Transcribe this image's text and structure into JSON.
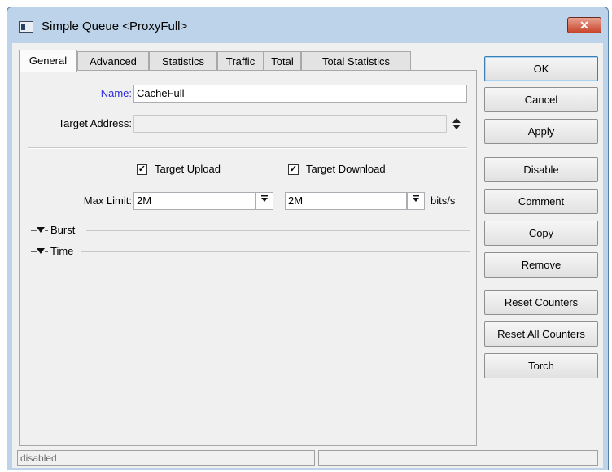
{
  "window": {
    "title": "Simple Queue <ProxyFull>",
    "close_glyph": "✕"
  },
  "tabs": [
    {
      "label": "General",
      "active": true
    },
    {
      "label": "Advanced"
    },
    {
      "label": "Statistics"
    },
    {
      "label": "Traffic"
    },
    {
      "label": "Total"
    },
    {
      "label": "Total Statistics"
    }
  ],
  "general": {
    "name_label": "Name:",
    "name_value": "CacheFull",
    "target_address_label": "Target Address:",
    "target_address_value": "",
    "target_upload_label": "Target Upload",
    "target_upload_checked": true,
    "target_download_label": "Target Download",
    "target_download_checked": true,
    "max_limit_label": "Max Limit:",
    "max_limit_upload": "2M",
    "max_limit_download": "2M",
    "max_limit_unit": "bits/s",
    "burst_label": "Burst",
    "time_label": "Time",
    "check_glyph": "✓"
  },
  "buttons": {
    "ok": "OK",
    "cancel": "Cancel",
    "apply": "Apply",
    "disable": "Disable",
    "comment": "Comment",
    "copy": "Copy",
    "remove": "Remove",
    "reset_counters": "Reset Counters",
    "reset_all_counters": "Reset All Counters",
    "torch": "Torch"
  },
  "status": {
    "left": "disabled",
    "right": ""
  },
  "icons": {
    "dropdown": "dropdown-arrow-icon",
    "updown": "up-down-arrows-icon",
    "section_toggle": "triangle-down-icon"
  }
}
